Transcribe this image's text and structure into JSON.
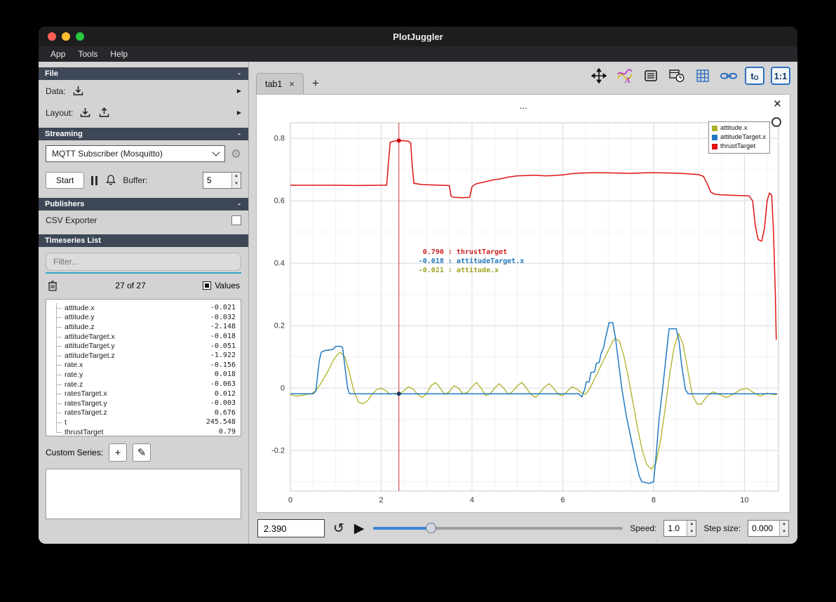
{
  "window": {
    "title": "PlotJuggler"
  },
  "menu": {
    "items": [
      "App",
      "Tools",
      "Help"
    ]
  },
  "icons": {
    "collapse": "-",
    "close": "×",
    "play": "▶",
    "loop": "↺",
    "pencil": "✎",
    "gear": "⚙",
    "expand_arrow": "▶",
    "plus": "+"
  },
  "sidebar": {
    "file": {
      "title": "File",
      "data_label": "Data:",
      "layout_label": "Layout:"
    },
    "streaming": {
      "title": "Streaming",
      "source_selected": "MQTT Subscriber (Mosquitto)",
      "start_label": "Start",
      "buffer_label": "Buffer:",
      "buffer_value": "5"
    },
    "publishers": {
      "title": "Publishers",
      "csv_exporter_label": "CSV Exporter"
    },
    "timeseries": {
      "title": "Timeseries List",
      "filter_placeholder": "Filter...",
      "count_text": "27 of 27",
      "values_label": "Values",
      "custom_series_label": "Custom Series:",
      "items": [
        {
          "name": "attitude.x",
          "value": "-0.021"
        },
        {
          "name": "attitude.y",
          "value": "-0.032"
        },
        {
          "name": "attitude.z",
          "value": "-2.148"
        },
        {
          "name": "attitudeTarget.x",
          "value": "-0.018"
        },
        {
          "name": "attitudeTarget.y",
          "value": "-0.051"
        },
        {
          "name": "attitudeTarget.z",
          "value": "-1.922"
        },
        {
          "name": "rate.x",
          "value": "-0.156"
        },
        {
          "name": "rate.y",
          "value": "0.018"
        },
        {
          "name": "rate.z",
          "value": "-0.063"
        },
        {
          "name": "ratesTarget.x",
          "value": "0.012"
        },
        {
          "name": "ratesTarget.y",
          "value": "-0.003"
        },
        {
          "name": "ratesTarget.z",
          "value": "0.676"
        },
        {
          "name": "t",
          "value": "245.548"
        },
        {
          "name": "thrustTarget",
          "value": "0.79"
        }
      ]
    }
  },
  "main": {
    "tabs": [
      {
        "label": "tab1"
      }
    ],
    "toolbar": {
      "icons": [
        "fullscreen-arrows",
        "curve-style",
        "legend-list",
        "time-clock",
        "grid",
        "link",
        "t0",
        "ratio-1-1"
      ],
      "t0_main": "t",
      "t0_sub": "O",
      "ratio": "1:1"
    },
    "playback": {
      "time_value": "2.390",
      "slider_fraction": 0.23,
      "speed_label": "Speed:",
      "speed_value": "1.0",
      "step_label": "Step size:",
      "step_value": "0.000"
    }
  },
  "chart_data": {
    "type": "line",
    "title": "...",
    "xlabel": "",
    "ylabel": "",
    "xlim": [
      0,
      10.75
    ],
    "ylim": [
      -0.33,
      0.85
    ],
    "xticks": [
      0,
      2,
      4,
      6,
      8,
      10
    ],
    "yticks": [
      -0.2,
      0,
      0.2,
      0.4,
      0.6,
      0.8
    ],
    "grid": true,
    "legend_position": "top-right",
    "series": [
      {
        "name": "attitude.x",
        "color": "#aeb026",
        "width": 1.3,
        "points": [
          [
            0,
            -0.021
          ],
          [
            0.15,
            -0.026
          ],
          [
            0.3,
            -0.022
          ],
          [
            0.45,
            -0.018
          ],
          [
            0.55,
            -0.01
          ],
          [
            0.65,
            0.01
          ],
          [
            0.75,
            0.035
          ],
          [
            0.85,
            0.06
          ],
          [
            0.95,
            0.09
          ],
          [
            1.05,
            0.11
          ],
          [
            1.1,
            0.115
          ],
          [
            1.2,
            0.1
          ],
          [
            1.3,
            0.05
          ],
          [
            1.4,
            -0.01
          ],
          [
            1.5,
            -0.045
          ],
          [
            1.6,
            -0.05
          ],
          [
            1.7,
            -0.04
          ],
          [
            1.8,
            -0.02
          ],
          [
            1.9,
            -0.005
          ],
          [
            2.0,
            0.0
          ],
          [
            2.1,
            -0.008
          ],
          [
            2.2,
            -0.02
          ],
          [
            2.3,
            -0.016
          ],
          [
            2.4,
            -0.021
          ],
          [
            2.5,
            -0.008
          ],
          [
            2.6,
            0.004
          ],
          [
            2.7,
            -0.002
          ],
          [
            2.8,
            -0.02
          ],
          [
            2.9,
            -0.03
          ],
          [
            3.0,
            -0.018
          ],
          [
            3.1,
            0.008
          ],
          [
            3.2,
            0.018
          ],
          [
            3.3,
            0.0
          ],
          [
            3.4,
            -0.02
          ],
          [
            3.5,
            -0.012
          ],
          [
            3.6,
            0.008
          ],
          [
            3.7,
            0.0
          ],
          [
            3.8,
            -0.018
          ],
          [
            3.9,
            -0.014
          ],
          [
            4.0,
            0.004
          ],
          [
            4.1,
            0.018
          ],
          [
            4.2,
            0.0
          ],
          [
            4.3,
            -0.024
          ],
          [
            4.4,
            -0.018
          ],
          [
            4.5,
            0.0
          ],
          [
            4.6,
            0.014
          ],
          [
            4.7,
            0.0
          ],
          [
            4.8,
            -0.02
          ],
          [
            4.9,
            -0.01
          ],
          [
            5.0,
            0.008
          ],
          [
            5.1,
            0.018
          ],
          [
            5.2,
            0.0
          ],
          [
            5.3,
            -0.02
          ],
          [
            5.4,
            -0.03
          ],
          [
            5.5,
            -0.014
          ],
          [
            5.6,
            0.004
          ],
          [
            5.7,
            0.014
          ],
          [
            5.8,
            0.0
          ],
          [
            5.9,
            -0.02
          ],
          [
            6.0,
            -0.024
          ],
          [
            6.1,
            -0.01
          ],
          [
            6.2,
            0.004
          ],
          [
            6.3,
            -0.002
          ],
          [
            6.4,
            -0.014
          ],
          [
            6.5,
            -0.02
          ],
          [
            6.6,
            0.0
          ],
          [
            6.7,
            0.03
          ],
          [
            6.8,
            0.06
          ],
          [
            6.9,
            0.09
          ],
          [
            7.0,
            0.12
          ],
          [
            7.1,
            0.15
          ],
          [
            7.15,
            0.16
          ],
          [
            7.25,
            0.15
          ],
          [
            7.35,
            0.1
          ],
          [
            7.45,
            0.03
          ],
          [
            7.55,
            -0.05
          ],
          [
            7.65,
            -0.13
          ],
          [
            7.75,
            -0.2
          ],
          [
            7.85,
            -0.245
          ],
          [
            7.95,
            -0.26
          ],
          [
            8.05,
            -0.24
          ],
          [
            8.15,
            -0.17
          ],
          [
            8.25,
            -0.07
          ],
          [
            8.35,
            0.04
          ],
          [
            8.45,
            0.13
          ],
          [
            8.55,
            0.175
          ],
          [
            8.65,
            0.14
          ],
          [
            8.75,
            0.06
          ],
          [
            8.85,
            -0.02
          ],
          [
            8.95,
            -0.05
          ],
          [
            9.05,
            -0.052
          ],
          [
            9.15,
            -0.03
          ],
          [
            9.3,
            -0.012
          ],
          [
            9.45,
            -0.02
          ],
          [
            9.6,
            -0.03
          ],
          [
            9.75,
            -0.02
          ],
          [
            9.9,
            -0.006
          ],
          [
            10.05,
            0.0
          ],
          [
            10.2,
            -0.014
          ],
          [
            10.35,
            -0.026
          ],
          [
            10.5,
            -0.016
          ],
          [
            10.6,
            -0.02
          ],
          [
            10.72,
            -0.021
          ]
        ]
      },
      {
        "name": "attitudeTarget.x",
        "color": "#2079c0",
        "width": 1.5,
        "points": [
          [
            0,
            -0.018
          ],
          [
            0.5,
            -0.018
          ],
          [
            0.56,
            -0.01
          ],
          [
            0.6,
            0.04
          ],
          [
            0.64,
            0.09
          ],
          [
            0.68,
            0.115
          ],
          [
            0.75,
            0.12
          ],
          [
            0.85,
            0.122
          ],
          [
            0.95,
            0.125
          ],
          [
            1.0,
            0.134
          ],
          [
            1.1,
            0.134
          ],
          [
            1.15,
            0.13
          ],
          [
            1.2,
            0.07
          ],
          [
            1.26,
            0.0
          ],
          [
            1.3,
            -0.018
          ],
          [
            2.0,
            -0.018
          ],
          [
            3.0,
            -0.018
          ],
          [
            4.0,
            -0.018
          ],
          [
            5.0,
            -0.018
          ],
          [
            6.0,
            -0.018
          ],
          [
            6.35,
            -0.018
          ],
          [
            6.42,
            -0.028
          ],
          [
            6.48,
            -0.005
          ],
          [
            6.52,
            0.02
          ],
          [
            6.58,
            0.02
          ],
          [
            6.62,
            0.05
          ],
          [
            6.7,
            0.052
          ],
          [
            6.74,
            0.08
          ],
          [
            6.8,
            0.082
          ],
          [
            6.84,
            0.11
          ],
          [
            6.9,
            0.13
          ],
          [
            6.94,
            0.16
          ],
          [
            6.98,
            0.185
          ],
          [
            7.02,
            0.21
          ],
          [
            7.1,
            0.21
          ],
          [
            7.16,
            0.16
          ],
          [
            7.22,
            0.09
          ],
          [
            7.3,
            0.0
          ],
          [
            7.4,
            -0.09
          ],
          [
            7.5,
            -0.16
          ],
          [
            7.6,
            -0.23
          ],
          [
            7.68,
            -0.28
          ],
          [
            7.74,
            -0.3
          ],
          [
            7.9,
            -0.305
          ],
          [
            8.0,
            -0.3
          ],
          [
            8.06,
            -0.21
          ],
          [
            8.12,
            -0.1
          ],
          [
            8.2,
            0.0
          ],
          [
            8.28,
            0.11
          ],
          [
            8.34,
            0.19
          ],
          [
            8.5,
            0.19
          ],
          [
            8.56,
            0.15
          ],
          [
            8.62,
            0.07
          ],
          [
            8.7,
            -0.005
          ],
          [
            8.76,
            -0.018
          ],
          [
            9.5,
            -0.018
          ],
          [
            10.72,
            -0.018
          ]
        ]
      },
      {
        "name": "thrustTarget",
        "color": "#e01212",
        "width": 1.5,
        "points": [
          [
            0,
            0.65
          ],
          [
            0.5,
            0.65
          ],
          [
            1.0,
            0.65
          ],
          [
            1.5,
            0.649
          ],
          [
            2.0,
            0.65
          ],
          [
            2.12,
            0.65
          ],
          [
            2.16,
            0.72
          ],
          [
            2.2,
            0.788
          ],
          [
            2.3,
            0.792
          ],
          [
            2.45,
            0.793
          ],
          [
            2.6,
            0.791
          ],
          [
            2.65,
            0.786
          ],
          [
            2.68,
            0.72
          ],
          [
            2.72,
            0.656
          ],
          [
            2.9,
            0.652
          ],
          [
            3.1,
            0.651
          ],
          [
            3.3,
            0.65
          ],
          [
            3.5,
            0.649
          ],
          [
            3.54,
            0.615
          ],
          [
            3.6,
            0.611
          ],
          [
            3.8,
            0.61
          ],
          [
            3.95,
            0.611
          ],
          [
            4.0,
            0.645
          ],
          [
            4.08,
            0.654
          ],
          [
            4.2,
            0.658
          ],
          [
            4.35,
            0.663
          ],
          [
            4.5,
            0.668
          ],
          [
            4.65,
            0.671
          ],
          [
            4.8,
            0.676
          ],
          [
            5.0,
            0.68
          ],
          [
            5.2,
            0.681
          ],
          [
            5.4,
            0.682
          ],
          [
            5.6,
            0.68
          ],
          [
            5.8,
            0.681
          ],
          [
            6.0,
            0.683
          ],
          [
            6.2,
            0.687
          ],
          [
            6.4,
            0.689
          ],
          [
            6.6,
            0.69
          ],
          [
            6.9,
            0.69
          ],
          [
            7.2,
            0.689
          ],
          [
            7.5,
            0.688
          ],
          [
            7.8,
            0.69
          ],
          [
            8.1,
            0.69
          ],
          [
            8.4,
            0.689
          ],
          [
            8.7,
            0.687
          ],
          [
            9.0,
            0.684
          ],
          [
            9.1,
            0.678
          ],
          [
            9.18,
            0.655
          ],
          [
            9.26,
            0.628
          ],
          [
            9.35,
            0.621
          ],
          [
            9.5,
            0.619
          ],
          [
            9.7,
            0.618
          ],
          [
            9.9,
            0.617
          ],
          [
            10.1,
            0.616
          ],
          [
            10.18,
            0.6
          ],
          [
            10.24,
            0.52
          ],
          [
            10.3,
            0.476
          ],
          [
            10.38,
            0.471
          ],
          [
            10.44,
            0.51
          ],
          [
            10.5,
            0.6
          ],
          [
            10.55,
            0.625
          ],
          [
            10.6,
            0.618
          ],
          [
            10.64,
            0.5
          ],
          [
            10.68,
            0.3
          ],
          [
            10.7,
            0.155
          ]
        ]
      }
    ],
    "tracker": {
      "x": 2.39,
      "label_anchor_y": 0.43,
      "labels": [
        {
          "text": " 0.790 : thrustTarget",
          "color": "#cc2222"
        },
        {
          "text": "-0.018 : attitudeTarget.x",
          "color": "#2079c0"
        },
        {
          "text": "-0.021 : attitude.x",
          "color": "#9fa31f"
        }
      ],
      "dots": [
        {
          "y": 0.793,
          "color": "#cc0000"
        },
        {
          "y": -0.018,
          "color": "#1d3461"
        }
      ]
    }
  }
}
